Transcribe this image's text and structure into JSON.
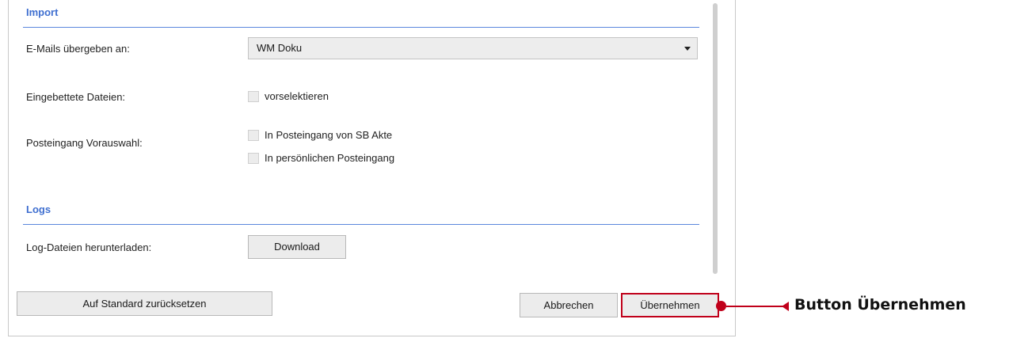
{
  "import": {
    "title": "Import",
    "emails_label": "E-Mails übergeben an:",
    "emails_value": "WM Doku",
    "embedded_label": "Eingebettete Dateien:",
    "embedded_option": "vorselektieren",
    "inbox_label": "Posteingang Vorauswahl:",
    "inbox_option_1": "In Posteingang von SB Akte",
    "inbox_option_2": "In persönlichen Posteingang"
  },
  "logs": {
    "title": "Logs",
    "download_label": "Log-Dateien herunterladen:",
    "download_button": "Download"
  },
  "footer": {
    "reset_button": "Auf Standard zurücksetzen",
    "cancel_button": "Abbrechen",
    "apply_button": "Übernehmen"
  },
  "callout": {
    "text": "Button Übernehmen",
    "color": "#c0001a"
  },
  "colors": {
    "section_title": "#3f6fd0",
    "section_line": "#5b87dd"
  }
}
